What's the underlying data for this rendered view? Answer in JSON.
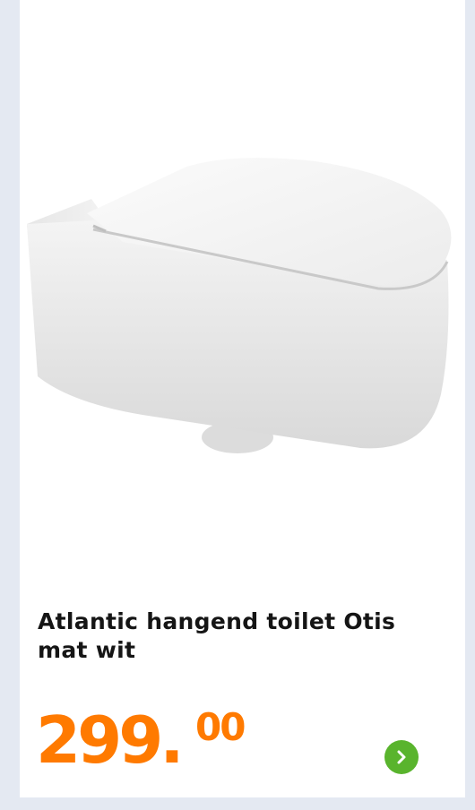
{
  "product": {
    "title": "Atlantic hangend toilet Otis mat wit",
    "price_whole": "299",
    "price_separator": ".",
    "price_cents": "00"
  },
  "colors": {
    "price": "#ff7a00",
    "button": "#59b42d",
    "background": "#e4e9f2"
  },
  "icons": {
    "next": "chevron-right-icon"
  }
}
